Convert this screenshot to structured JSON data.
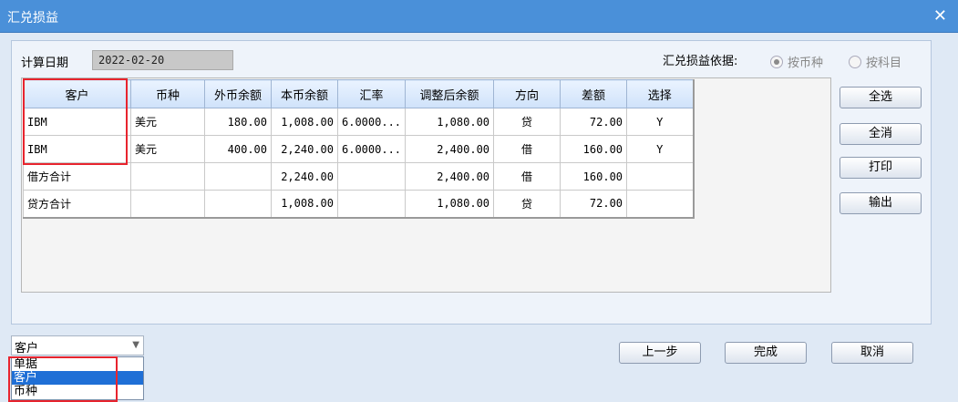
{
  "window": {
    "title": "汇兑损益",
    "close_glyph": "✕"
  },
  "form": {
    "calc_date_label": "计算日期",
    "calc_date_value": "2022-02-20",
    "basis_label": "汇兑损益依据:",
    "basis_options": [
      {
        "label": "按币种",
        "selected": true
      },
      {
        "label": "按科目",
        "selected": false
      }
    ]
  },
  "table": {
    "columns": [
      "客户",
      "币种",
      "外币余额",
      "本币余额",
      "汇率",
      "调整后余额",
      "方向",
      "差额",
      "选择"
    ],
    "rows": [
      [
        "IBM",
        "美元",
        "180.00",
        "1,008.00",
        "6.0000...",
        "1,080.00",
        "贷",
        "72.00",
        "Y"
      ],
      [
        "IBM",
        "美元",
        "400.00",
        "2,240.00",
        "6.0000...",
        "2,400.00",
        "借",
        "160.00",
        "Y"
      ],
      [
        "借方合计",
        "",
        "",
        "2,240.00",
        "",
        "2,400.00",
        "借",
        "160.00",
        ""
      ],
      [
        "贷方合计",
        "",
        "",
        "1,008.00",
        "",
        "1,080.00",
        "贷",
        "72.00",
        ""
      ]
    ]
  },
  "side_buttons": [
    "全选",
    "全消",
    "打印",
    "输出"
  ],
  "groupby": {
    "selected": "客户",
    "options": [
      "单据",
      "客户",
      "币种"
    ],
    "highlighted_index": 1
  },
  "footer_buttons": {
    "prev": "上一步",
    "finish": "完成",
    "cancel": "取消"
  },
  "colors": {
    "titlebar": "#4a90d9",
    "highlight_box": "#e8242e",
    "selected_option": "#1f6fd6"
  }
}
